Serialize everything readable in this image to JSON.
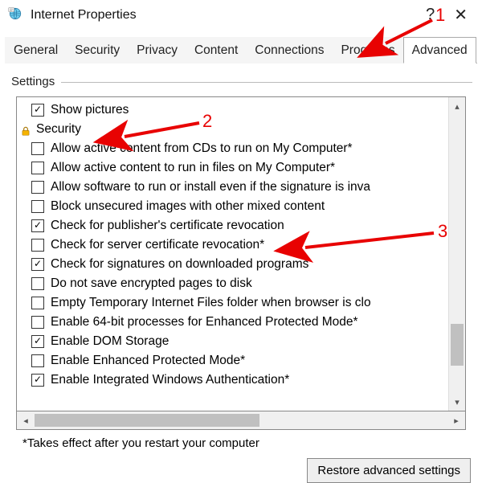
{
  "window": {
    "title": "Internet Properties",
    "help_label": "?",
    "close_label": "✕"
  },
  "tabs": [
    {
      "label": "General",
      "selected": false
    },
    {
      "label": "Security",
      "selected": false
    },
    {
      "label": "Privacy",
      "selected": false
    },
    {
      "label": "Content",
      "selected": false
    },
    {
      "label": "Connections",
      "selected": false
    },
    {
      "label": "Programs",
      "selected": false
    },
    {
      "label": "Advanced",
      "selected": true
    }
  ],
  "group_label": "Settings",
  "category": "Security",
  "items": [
    {
      "label": "Show pictures",
      "checked": true,
      "is_category_child": false
    },
    {
      "label": "Allow active content from CDs to run on My Computer*",
      "checked": false,
      "is_category_child": true
    },
    {
      "label": "Allow active content to run in files on My Computer*",
      "checked": false,
      "is_category_child": true
    },
    {
      "label": "Allow software to run or install even if the signature is inva",
      "checked": false,
      "is_category_child": true
    },
    {
      "label": "Block unsecured images with other mixed content",
      "checked": false,
      "is_category_child": true
    },
    {
      "label": "Check for publisher's certificate revocation",
      "checked": true,
      "is_category_child": true
    },
    {
      "label": "Check for server certificate revocation*",
      "checked": false,
      "is_category_child": true
    },
    {
      "label": "Check for signatures on downloaded programs",
      "checked": true,
      "is_category_child": true
    },
    {
      "label": "Do not save encrypted pages to disk",
      "checked": false,
      "is_category_child": true
    },
    {
      "label": "Empty Temporary Internet Files folder when browser is clo",
      "checked": false,
      "is_category_child": true
    },
    {
      "label": "Enable 64-bit processes for Enhanced Protected Mode*",
      "checked": false,
      "is_category_child": true
    },
    {
      "label": "Enable DOM Storage",
      "checked": true,
      "is_category_child": true
    },
    {
      "label": "Enable Enhanced Protected Mode*",
      "checked": false,
      "is_category_child": true
    },
    {
      "label": "Enable Integrated Windows Authentication*",
      "checked": true,
      "is_category_child": true
    }
  ],
  "footnote": "*Takes effect after you restart your computer",
  "restore_label": "Restore advanced settings",
  "annotations": {
    "n1": "1",
    "n2": "2",
    "n3": "3"
  }
}
